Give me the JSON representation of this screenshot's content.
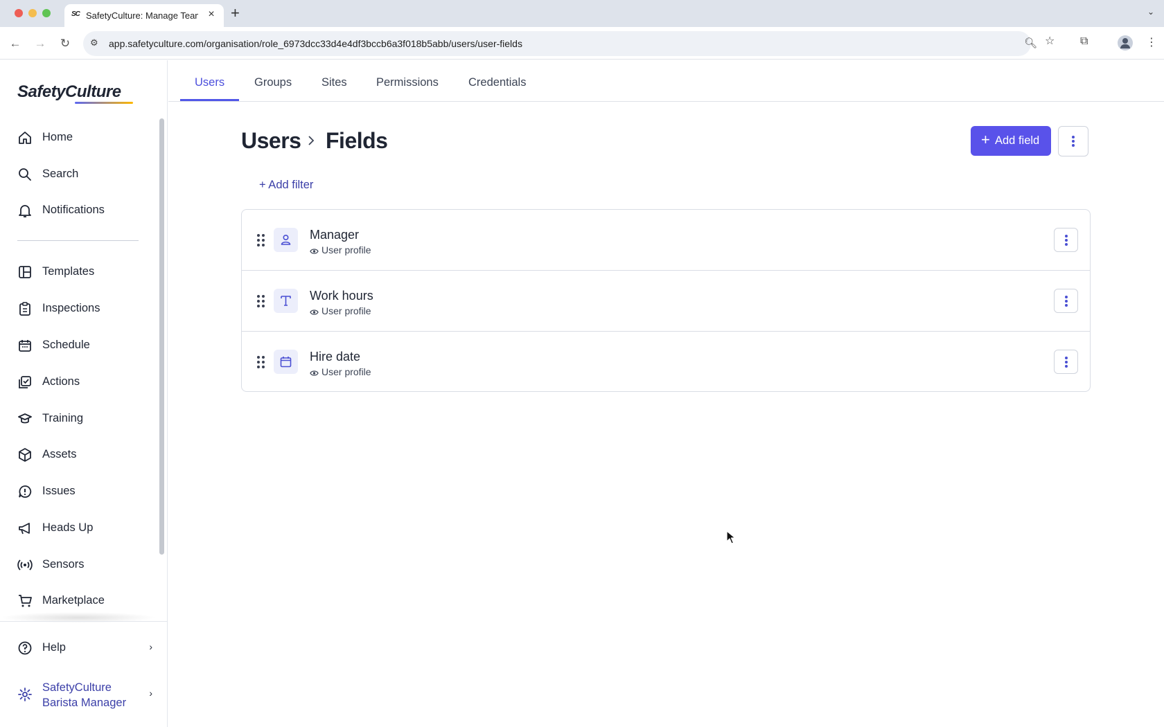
{
  "browser": {
    "tab_title": "SafetyCulture: Manage Teams",
    "favicon_text": "SC",
    "url": "app.safetyculture.com/organisation/role_6973dcc33d4e4df3bccb6a3f018b5abb/users/user-fields"
  },
  "sidebar": {
    "logo": "SafetyCulture",
    "items": [
      {
        "label": "Home",
        "icon": "home-icon"
      },
      {
        "label": "Search",
        "icon": "search-icon"
      },
      {
        "label": "Notifications",
        "icon": "bell-icon"
      },
      {
        "label": "Templates",
        "icon": "templates-icon"
      },
      {
        "label": "Inspections",
        "icon": "clipboard-icon"
      },
      {
        "label": "Schedule",
        "icon": "calendar-icon"
      },
      {
        "label": "Actions",
        "icon": "checkbox-icon"
      },
      {
        "label": "Training",
        "icon": "graduation-cap-icon"
      },
      {
        "label": "Assets",
        "icon": "cube-icon"
      },
      {
        "label": "Issues",
        "icon": "alert-icon"
      },
      {
        "label": "Heads Up",
        "icon": "megaphone-icon"
      },
      {
        "label": "Sensors",
        "icon": "sensor-icon"
      },
      {
        "label": "Marketplace",
        "icon": "cart-icon"
      }
    ],
    "help": "Help",
    "org_line1": "SafetyCulture",
    "org_line2": "Barista Manager"
  },
  "tabs": [
    {
      "label": "Users",
      "active": true
    },
    {
      "label": "Groups",
      "active": false
    },
    {
      "label": "Sites",
      "active": false
    },
    {
      "label": "Permissions",
      "active": false
    },
    {
      "label": "Credentials",
      "active": false
    }
  ],
  "breadcrumb": {
    "parent": "Users",
    "current": "Fields"
  },
  "actions": {
    "add_field": "Add field",
    "add_filter": "+ Add filter"
  },
  "fields": [
    {
      "name": "Manager",
      "type_icon": "person-icon",
      "visibility": "User profile"
    },
    {
      "name": "Work hours",
      "type_icon": "text-type-icon",
      "visibility": "User profile"
    },
    {
      "name": "Hire date",
      "type_icon": "calendar-icon",
      "visibility": "User profile"
    }
  ],
  "colors": {
    "accent": "#5952ea",
    "link": "#3b3fa8"
  }
}
